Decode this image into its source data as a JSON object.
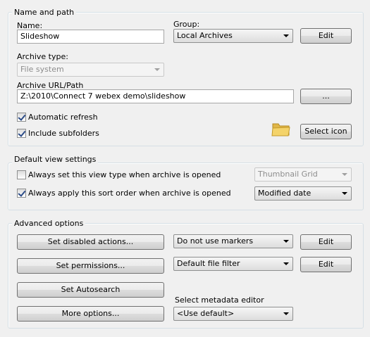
{
  "name_and_path": {
    "title": "Name and path",
    "name_label": "Name:",
    "name_value": "Slideshow",
    "group_label": "Group:",
    "group_value": "Local Archives",
    "edit_label": "Edit",
    "archive_type_label": "Archive type:",
    "archive_type_value": "File system",
    "archive_url_label": "Archive URL/Path",
    "archive_url_value": "Z:\\2010\\Connect 7 webex demo\\slideshow",
    "browse_label": "...",
    "auto_refresh_label": "Automatic refresh",
    "auto_refresh_checked": true,
    "include_subfolders_label": "Include subfolders",
    "include_subfolders_checked": true,
    "select_icon_label": "Select icon",
    "folder_icon": "folder-icon"
  },
  "default_view": {
    "title": "Default view settings",
    "view_type_label": "Always set this view type when archive is opened",
    "view_type_checked": false,
    "view_type_value": "Thumbnail Grid",
    "sort_order_label": "Always apply this sort order when archive is opened",
    "sort_order_checked": true,
    "sort_order_value": "Modified date"
  },
  "advanced": {
    "title": "Advanced options",
    "disabled_actions_label": "Set disabled actions...",
    "permissions_label": "Set permissions...",
    "autosearch_label": "Set Autosearch",
    "more_options_label": "More options...",
    "markers_value": "Do not use markers",
    "markers_edit_label": "Edit",
    "file_filter_value": "Default file filter",
    "file_filter_edit_label": "Edit",
    "metadata_editor_label": "Select metadata editor",
    "metadata_editor_value": "<Use default>"
  },
  "colors": {
    "window_bg": "#f0f0f0",
    "group_border": "#d5dfe5",
    "check_mark": "#2b4b87",
    "folder_yellow": "#f4d36a"
  }
}
